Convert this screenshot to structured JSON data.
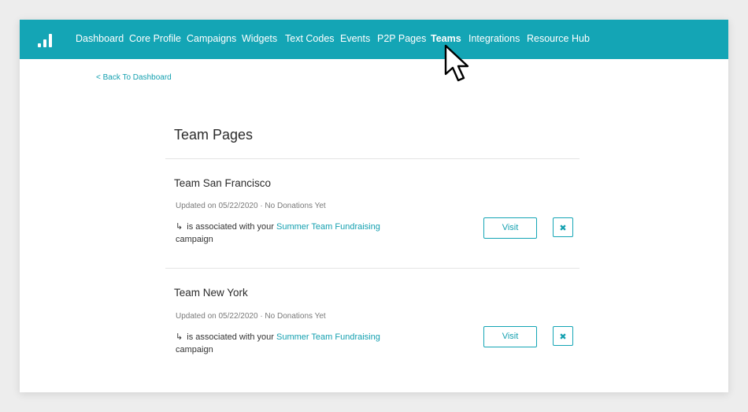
{
  "nav": {
    "logo_icon": "bar-signal-logo",
    "items": [
      {
        "label": "Dashboard"
      },
      {
        "label": "Core Profile"
      },
      {
        "label": "Campaigns"
      },
      {
        "label": "Widgets"
      },
      {
        "label": "Text Codes"
      },
      {
        "label": "Events"
      },
      {
        "label": "P2P Pages"
      },
      {
        "label": "Teams",
        "active": true
      },
      {
        "label": "Integrations"
      },
      {
        "label": "Resource Hub"
      }
    ]
  },
  "back_link": "< Back To Dashboard",
  "page_title": "Team Pages",
  "teams": [
    {
      "name": "Team San Francisco",
      "meta": "Updated on 05/22/2020 · No Donations Yet",
      "assoc_arrow": "↳",
      "assoc_prefix": "is associated with your ",
      "campaign": "Summer Team Fundraising",
      "assoc_suffix": "campaign",
      "visit_label": "Visit",
      "delete_label": "✖"
    },
    {
      "name": "Team New York",
      "meta": "Updated on 05/22/2020 · No Donations Yet",
      "assoc_arrow": "↳",
      "assoc_prefix": "is associated with your ",
      "campaign": "Summer Team Fundraising",
      "assoc_suffix": "campaign",
      "visit_label": "Visit",
      "delete_label": "✖"
    }
  ],
  "colors": {
    "brand": "#14a5b5",
    "link": "#14a0b0",
    "background": "#ededed"
  },
  "cursor_icon": "mouse-pointer-icon"
}
